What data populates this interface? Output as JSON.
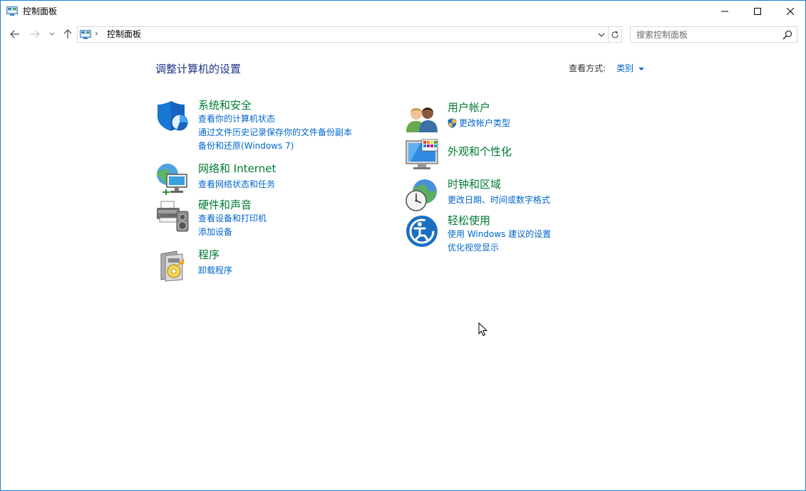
{
  "window": {
    "title": "控制面板"
  },
  "address_bar": {
    "path": "控制面板",
    "separator": "›"
  },
  "search": {
    "placeholder": "搜索控制面板"
  },
  "content": {
    "heading": "调整计算机的设置",
    "view_by_label": "查看方式:",
    "view_by_value": "类别"
  },
  "categories": {
    "system_security": {
      "title": "系统和安全",
      "icon": "shield-icon",
      "links": [
        "查看你的计算机状态",
        "通过文件历史记录保存你的文件备份副本",
        "备份和还原(Windows 7)"
      ]
    },
    "network": {
      "title": "网络和 Internet",
      "icon": "network-globe-icon",
      "links": [
        "查看网络状态和任务"
      ]
    },
    "hardware_sound": {
      "title": "硬件和声音",
      "icon": "printer-speaker-icon",
      "links": [
        "查看设备和打印机",
        "添加设备"
      ]
    },
    "programs": {
      "title": "程序",
      "icon": "programs-disc-icon",
      "links": [
        "卸载程序"
      ]
    },
    "user_accounts": {
      "title": "用户帐户",
      "icon": "users-icon",
      "links": [
        "更改帐户类型"
      ]
    },
    "appearance": {
      "title": "外观和个性化",
      "icon": "monitor-palette-icon",
      "links": []
    },
    "clock_region": {
      "title": "时钟和区域",
      "icon": "clock-globe-icon",
      "links": [
        "更改日期、时间或数字格式"
      ]
    },
    "ease_of_access": {
      "title": "轻松使用",
      "icon": "ease-of-access-icon",
      "links": [
        "使用 Windows 建议的设置",
        "优化视觉显示"
      ]
    }
  },
  "colors": {
    "accent": "#1883d7",
    "link": "#0066cc",
    "category_title": "#007a33",
    "heading": "#1e3287"
  }
}
